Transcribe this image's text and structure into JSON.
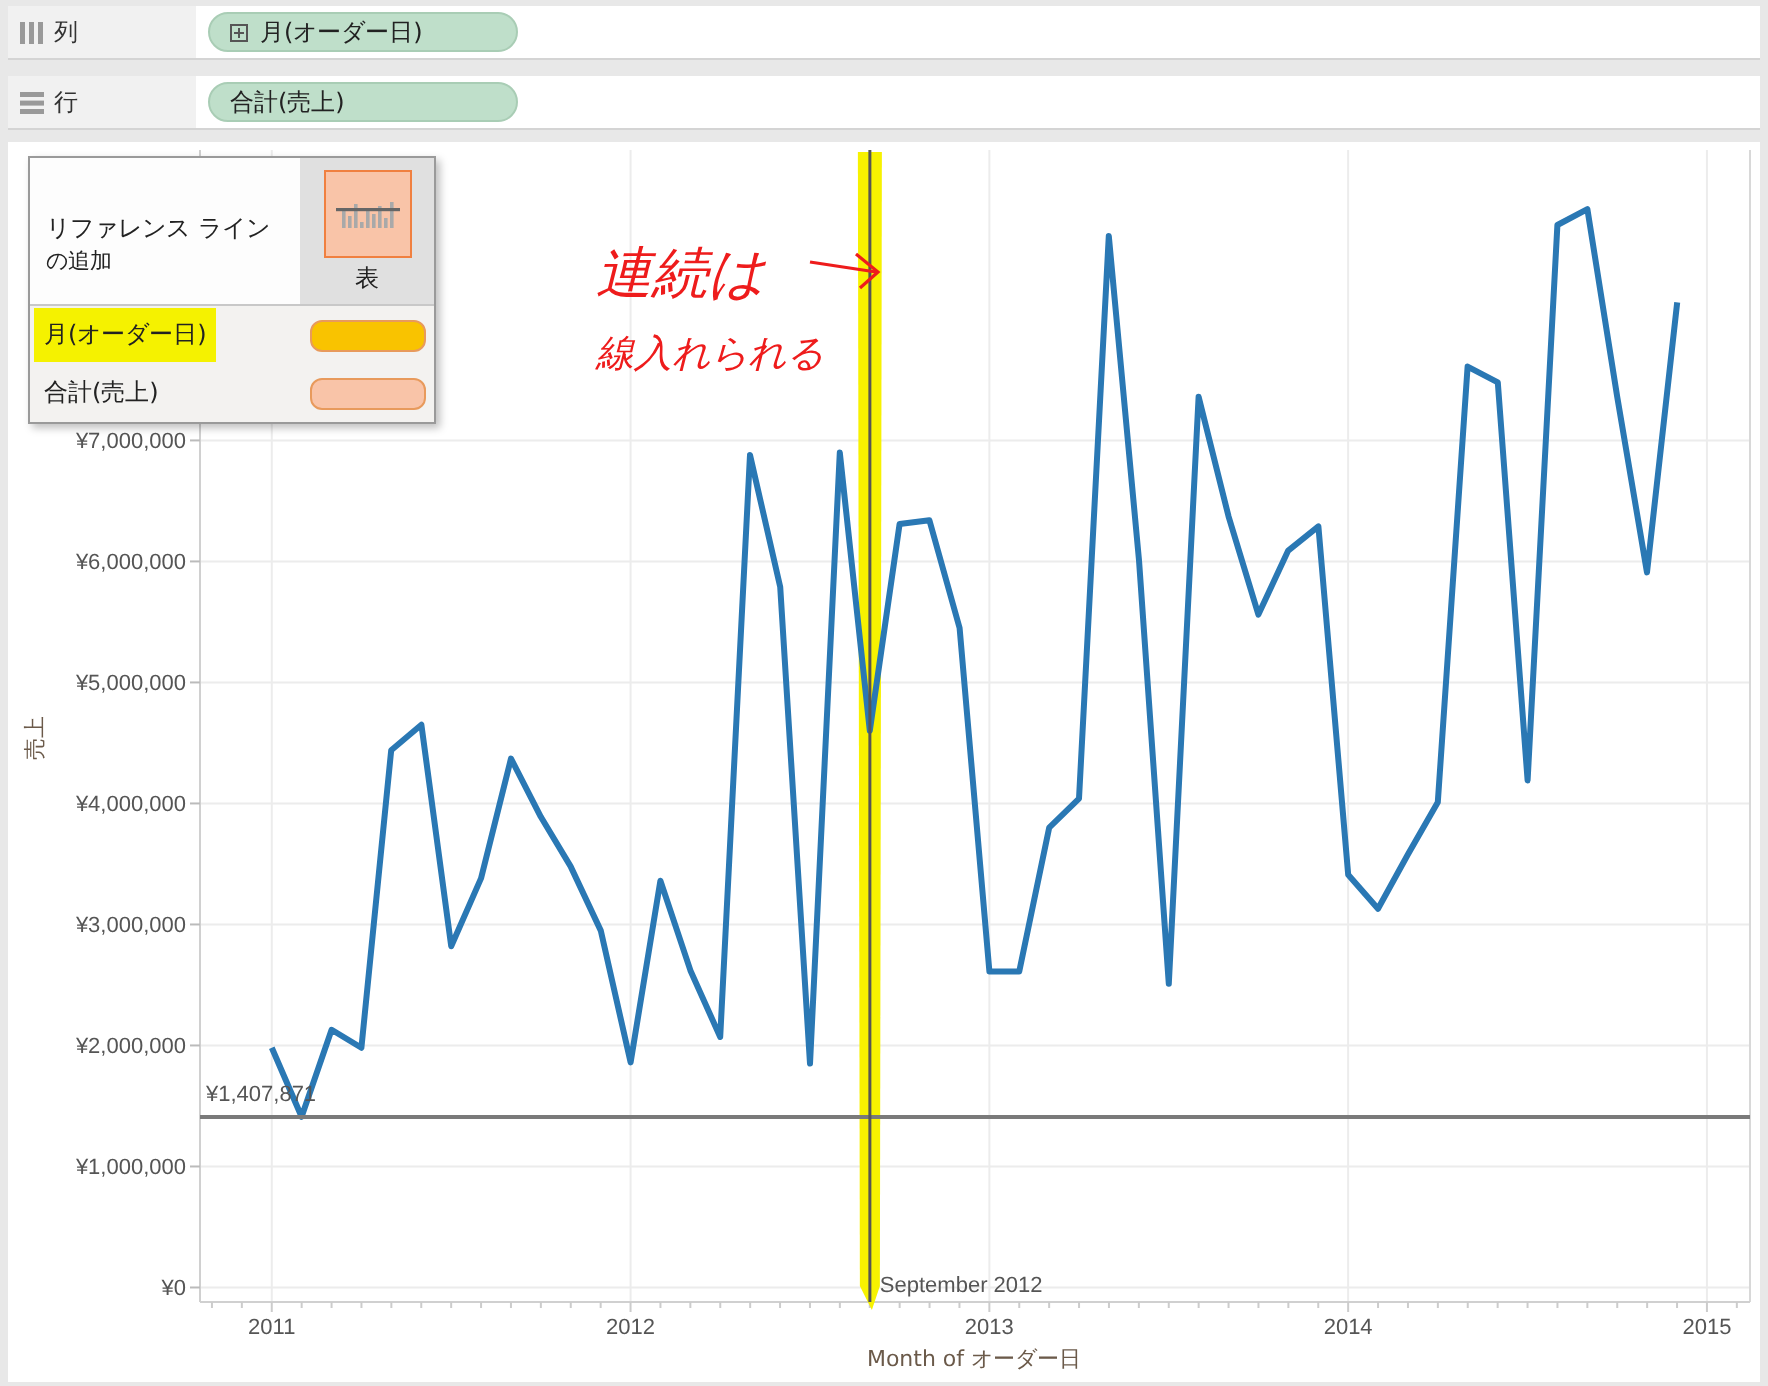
{
  "shelves": [
    {
      "label": "列",
      "kind": "columns",
      "pill": {
        "text": "月(オーダー日)",
        "expandable": true
      }
    },
    {
      "label": "行",
      "kind": "rows",
      "pill": {
        "text": "合計(売上)",
        "expandable": false
      }
    }
  ],
  "chart": {
    "chart_data": {
      "type": "line",
      "xlabel": "Month of オーダー日",
      "ylabel": "売上",
      "x": [
        2011,
        2011.083,
        2011.167,
        2011.25,
        2011.333,
        2011.417,
        2011.5,
        2011.583,
        2011.667,
        2011.75,
        2011.833,
        2011.917,
        2012,
        2012.083,
        2012.167,
        2012.25,
        2012.333,
        2012.417,
        2012.5,
        2012.583,
        2012.667,
        2012.75,
        2012.833,
        2012.917,
        2013,
        2013.083,
        2013.167,
        2013.25,
        2013.333,
        2013.417,
        2013.5,
        2013.583,
        2013.667,
        2013.75,
        2013.833,
        2013.917,
        2014,
        2014.083,
        2014.167,
        2014.25,
        2014.333,
        2014.417,
        2014.5,
        2014.583,
        2014.667,
        2014.75,
        2014.833,
        2014.917
      ],
      "series": [
        {
          "color": "#2a78b4",
          "values": [
            1980000,
            1410000,
            2130000,
            1980000,
            4440000,
            4650000,
            2820000,
            3380000,
            4370000,
            3890000,
            3480000,
            2950000,
            1860000,
            3360000,
            2620000,
            2070000,
            6880000,
            5790000,
            1850000,
            6900000,
            4600000,
            6310000,
            6340000,
            5450000,
            2610000,
            2610000,
            3800000,
            4040000,
            8690000,
            6010000,
            2510000,
            7360000,
            6370000,
            5560000,
            6090000,
            6290000,
            3410000,
            3130000,
            3580000,
            4010000,
            7610000,
            7480000,
            4190000,
            8780000,
            8910000,
            7360000,
            5910000,
            8140000
          ]
        }
      ],
      "xlim": [
        2010.8,
        2015.12
      ],
      "ylim": [
        -120000,
        9400000
      ],
      "grid": true,
      "xticks": [
        2011,
        2012,
        2013,
        2014,
        2015
      ],
      "yticks": [
        {
          "value": 0,
          "label": "¥0"
        },
        {
          "value": 1000000,
          "label": "¥1,000,000"
        },
        {
          "value": 2000000,
          "label": "¥2,000,000"
        },
        {
          "value": 3000000,
          "label": "¥3,000,000"
        },
        {
          "value": 4000000,
          "label": "¥4,000,000"
        },
        {
          "value": 5000000,
          "label": "¥5,000,000"
        },
        {
          "value": 6000000,
          "label": "¥6,000,000"
        },
        {
          "value": 7000000,
          "label": "¥7,000,000"
        }
      ],
      "ref_lines": [
        {
          "axis": "y",
          "value": 1407871,
          "label": "¥1,407,871"
        },
        {
          "axis": "x",
          "value": 2012.667,
          "label": "September 2012"
        }
      ]
    }
  },
  "popup": {
    "title": "リファレンス ライン",
    "subtitle": "の追加",
    "options": [
      {
        "label": "表",
        "selected": true
      }
    ],
    "fields": [
      {
        "label": "月(オーダー日)",
        "color": "#f9c300",
        "highlighted": true
      },
      {
        "label": "合計(売上)",
        "color": "#f9c4a8",
        "highlighted": false
      }
    ]
  },
  "note": {
    "lines": [
      "連続は",
      "線入れられる"
    ],
    "highlights_line": true
  }
}
